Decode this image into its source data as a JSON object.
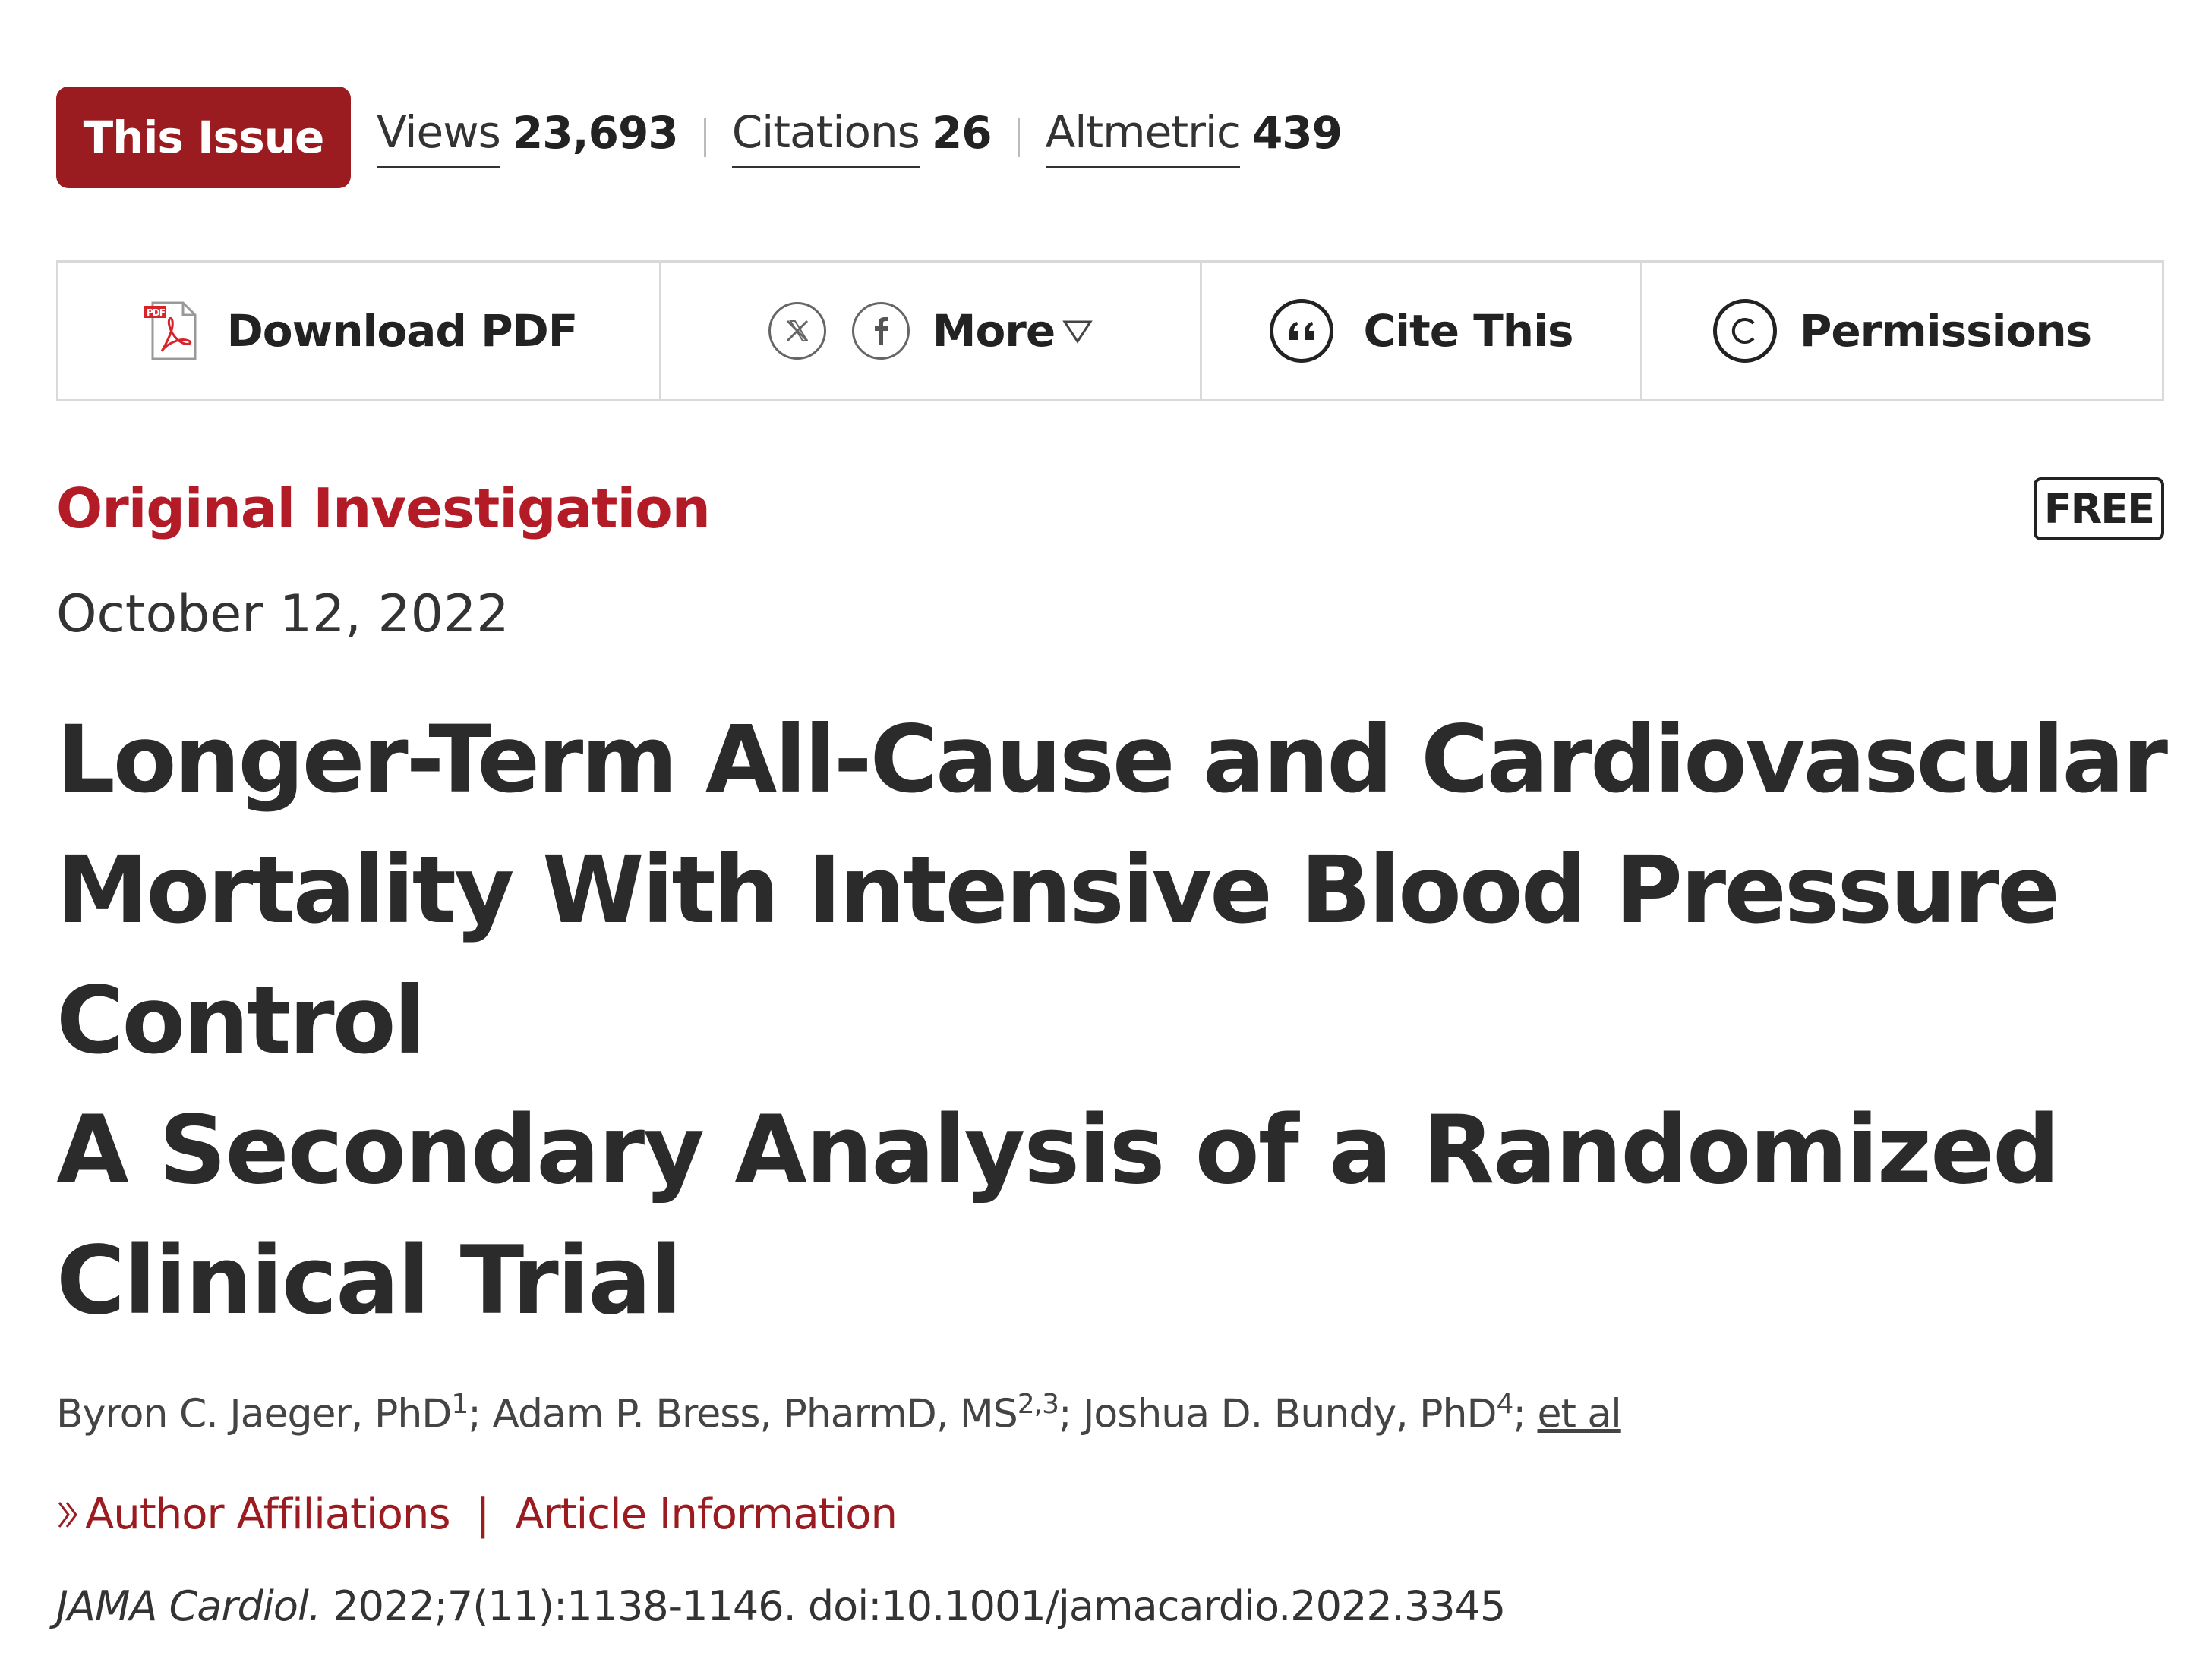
{
  "metrics": {
    "issue_button": "This Issue",
    "views_label": "Views",
    "views_value": "23,693",
    "citations_label": "Citations",
    "citations_value": "26",
    "altmetric_label": "Altmetric",
    "altmetric_value": "439"
  },
  "toolbar": {
    "download_label": "Download PDF",
    "more_label": "More",
    "cite_label": "Cite This",
    "permissions_label": "Permissions"
  },
  "icons": [
    "pdf-icon",
    "x-twitter-icon",
    "facebook-icon",
    "caret-down-icon",
    "quote-icon",
    "copyright-icon",
    "double-chevron-right-icon"
  ],
  "colors": {
    "brand_red": "#9b1c20",
    "type_red": "#b31b27"
  },
  "article": {
    "type": "Original Investigation",
    "free_badge": "FREE",
    "date": "October 12, 2022",
    "title": "Longer-Term All-Cause and Cardiovascular Mortality With Intensive Blood Pressure Control",
    "subtitle": "A Secondary Analysis of a Randomized Clinical Trial",
    "authors": [
      {
        "name": "Byron C. Jaeger, PhD",
        "sup": "1",
        "sep": "; "
      },
      {
        "name": "Adam P. Bress, PharmD, MS",
        "sup": "2,3",
        "sep": "; "
      },
      {
        "name": "Joshua D. Bundy, PhD",
        "sup": "4",
        "sep": "; "
      }
    ],
    "et_al": "et al",
    "author_affiliations": "Author Affiliations",
    "link_separator": "|",
    "article_information": "Article Information",
    "journal": "JAMA Cardiol.",
    "citation": " 2022;7(11):1138-1146. doi:10.1001/jamacardio.2022.3345"
  }
}
